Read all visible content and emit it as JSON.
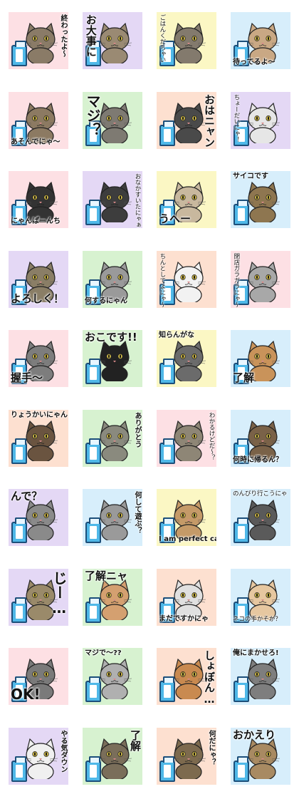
{
  "stickers": [
    {
      "caption": "終わったよ～",
      "bg": "#fde0e4",
      "fur": "#8a7b67",
      "orient": "v",
      "pos": "v-right",
      "size": "small"
    },
    {
      "caption": "お大事に",
      "bg": "#e4d8f5",
      "fur": "#9a8a73",
      "orient": "v",
      "pos": "v-left",
      "size": "med"
    },
    {
      "caption": "ごはんくだちゃい",
      "bg": "#fbf7c4",
      "fur": "#837a6d",
      "orient": "v",
      "pos": "v-left",
      "size": "tiny"
    },
    {
      "caption": "待ってるよ～",
      "bg": "#d7eefb",
      "fur": "#c9a884",
      "orient": "h",
      "pos": "h-bottom",
      "size": "small"
    },
    {
      "caption": "あそんでにゃ～",
      "bg": "#fde0e4",
      "fur": "#8c7a62",
      "orient": "h",
      "pos": "h-bottom",
      "size": "small"
    },
    {
      "caption": "マジ？",
      "bg": "#d7f2d0",
      "fur": "#7e7a72",
      "orient": "v",
      "pos": "v-left",
      "size": "big"
    },
    {
      "caption": "おはニャン",
      "bg": "#fde0d0",
      "fur": "#4a4a4a",
      "orient": "v",
      "pos": "v-right",
      "size": "med"
    },
    {
      "caption": "ちょーだいにゃ！",
      "bg": "#e4d8f5",
      "fur": "#e6e6e6",
      "orient": "v",
      "pos": "v-left",
      "size": "tiny"
    },
    {
      "caption": "にゃんぱーんち",
      "bg": "#fde0e4",
      "fur": "#333333",
      "orient": "h",
      "pos": "h-bottom",
      "size": "small"
    },
    {
      "caption": "おなかすいたにゃぁ",
      "bg": "#e4d8f5",
      "fur": "#3d3d3d",
      "orient": "v",
      "pos": "v-right",
      "size": "tiny"
    },
    {
      "caption": "うへー",
      "bg": "#fbf7c4",
      "fur": "#c8b89e",
      "orient": "h",
      "pos": "h-bottom",
      "size": "med"
    },
    {
      "caption": "サイコです",
      "bg": "#d7eefb",
      "fur": "#8e7650",
      "orient": "h",
      "pos": "h-top",
      "size": "small"
    },
    {
      "caption": "よろしく！",
      "bg": "#e4d8f5",
      "fur": "#8a7e66",
      "orient": "h",
      "pos": "h-bottom",
      "size": "med"
    },
    {
      "caption": "何するにゃん",
      "bg": "#d7f2d0",
      "fur": "#9a9a9a",
      "orient": "h",
      "pos": "h-bottom",
      "size": "small"
    },
    {
      "caption": "ちんとしてよにゃ～",
      "bg": "#fde0d0",
      "fur": "#f2f2f2",
      "orient": "v",
      "pos": "v-left",
      "size": "tiny"
    },
    {
      "caption": "閉店ガラガラにゃ～",
      "bg": "#fde0e4",
      "fur": "#a8a8a8",
      "orient": "v",
      "pos": "v-left",
      "size": "tiny"
    },
    {
      "caption": "握手～",
      "bg": "#fde0e4",
      "fur": "#7d7d7d",
      "orient": "h",
      "pos": "h-bottom",
      "size": "med"
    },
    {
      "caption": "おこです!!",
      "bg": "#d7f2d0",
      "fur": "#222222",
      "orient": "h",
      "pos": "h-top",
      "size": "med"
    },
    {
      "caption": "知らんがな",
      "bg": "#fbf7c4",
      "fur": "#6b6b6b",
      "orient": "h",
      "pos": "h-top",
      "size": "small"
    },
    {
      "caption": "了解",
      "bg": "#d7eefb",
      "fur": "#c9935a",
      "orient": "h",
      "pos": "h-bottom",
      "size": "med"
    },
    {
      "caption": "りょうかいにゃん",
      "bg": "#fde0d0",
      "fur": "#6a5440",
      "orient": "h",
      "pos": "h-top",
      "size": "small"
    },
    {
      "caption": "ありがとう",
      "bg": "#d7f2d0",
      "fur": "#8a8a7e",
      "orient": "v",
      "pos": "v-right",
      "size": "small"
    },
    {
      "caption": "わかるけどだ～？",
      "bg": "#fde0e4",
      "fur": "#8e8676",
      "orient": "v",
      "pos": "v-right",
      "size": "tiny"
    },
    {
      "caption": "何時に帰るん？",
      "bg": "#d7eefb",
      "fur": "#7a6248",
      "orient": "h",
      "pos": "h-bottom",
      "size": "small"
    },
    {
      "caption": "んで？",
      "bg": "#e4d8f5",
      "fur": "#8a8a8a",
      "orient": "h",
      "pos": "h-top",
      "size": "med"
    },
    {
      "caption": "何して遊ぶ？",
      "bg": "#d7eefb",
      "fur": "#9a9a9a",
      "orient": "v",
      "pos": "v-right",
      "size": "small"
    },
    {
      "caption": "I am perfect cat",
      "bg": "#fbf7c4",
      "fur": "#c59a68",
      "orient": "h",
      "pos": "h-bottom",
      "size": "small"
    },
    {
      "caption": "のんびり行こうにゃ",
      "bg": "#d7eefb",
      "fur": "#5a5a5a",
      "orient": "h",
      "pos": "h-top",
      "size": "tiny"
    },
    {
      "caption": "じー…",
      "bg": "#e4d8f5",
      "fur": "#9a8a6a",
      "orient": "v",
      "pos": "v-right",
      "size": "big"
    },
    {
      "caption": "了解ニャ",
      "bg": "#d7f2d0",
      "fur": "#d4a070",
      "orient": "h",
      "pos": "h-top",
      "size": "med"
    },
    {
      "caption": "まだですかにゃ",
      "bg": "#fde0d0",
      "fur": "#e0e0e0",
      "orient": "h",
      "pos": "h-bottom",
      "size": "small"
    },
    {
      "caption": "ネコの手かそか？",
      "bg": "#d7eefb",
      "fur": "#e6c7a0",
      "orient": "h",
      "pos": "h-bottom",
      "size": "tiny"
    },
    {
      "caption": "OK!",
      "bg": "#fde0e4",
      "fur": "#7a7a7a",
      "orient": "h",
      "pos": "h-bottom",
      "size": "big"
    },
    {
      "caption": "マジで～??",
      "bg": "#d7f2d0",
      "fur": "#b0b0b0",
      "orient": "h",
      "pos": "h-top",
      "size": "small"
    },
    {
      "caption": "しょぼん…",
      "bg": "#fde0d0",
      "fur": "#c98a50",
      "orient": "v",
      "pos": "v-right",
      "size": "med"
    },
    {
      "caption": "俺にまかせろ!",
      "bg": "#d7eefb",
      "fur": "#7e7e7e",
      "orient": "h",
      "pos": "h-top",
      "size": "small"
    },
    {
      "caption": "やる気ダウン",
      "bg": "#e4d8f5",
      "fur": "#f0f0f0",
      "orient": "v",
      "pos": "v-right",
      "size": "small"
    },
    {
      "caption": "了解",
      "bg": "#d7f2d0",
      "fur": "#7a6e5a",
      "orient": "v",
      "pos": "v-right",
      "size": "med"
    },
    {
      "caption": "何だにゃ？",
      "bg": "#fde0d0",
      "fur": "#7d6a4e",
      "orient": "v",
      "pos": "v-right",
      "size": "small"
    },
    {
      "caption": "おかえり",
      "bg": "#d7eefb",
      "fur": "#a88a62",
      "orient": "h",
      "pos": "h-top",
      "size": "med"
    }
  ]
}
